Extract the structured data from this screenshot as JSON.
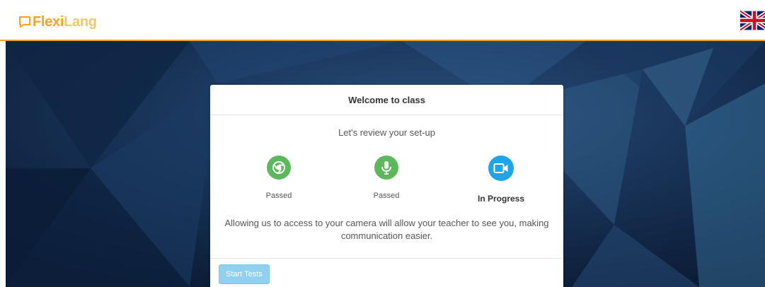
{
  "header": {
    "logo_part1": "Flexi",
    "logo_part2": "Lang",
    "language_flag": "uk-flag-icon"
  },
  "card": {
    "title": "Welcome to class",
    "subtitle": "Let's review your set-up",
    "steps": [
      {
        "icon": "chrome-icon",
        "status": "Passed",
        "color": "#5cb85c"
      },
      {
        "icon": "microphone-icon",
        "status": "Passed",
        "color": "#5cb85c"
      },
      {
        "icon": "video-camera-icon",
        "status": "In Progress",
        "color": "#1ea5e9"
      }
    ],
    "description": "Allowing us to access to your camera will allow your teacher to see you, making communication easier.",
    "start_button_label": "Start Tests"
  },
  "colors": {
    "brand": "#f3a51c",
    "passed": "#5cb85c",
    "in_progress": "#1ea5e9",
    "button": "#8fd1ee"
  }
}
